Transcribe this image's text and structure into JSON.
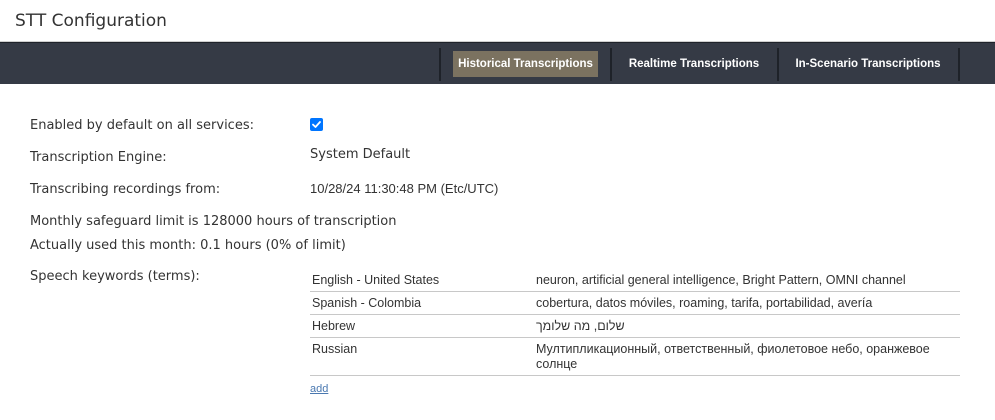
{
  "page": {
    "title": "STT Configuration"
  },
  "tabs": [
    {
      "label": "Historical Transcriptions",
      "active": true
    },
    {
      "label": "Realtime Transcriptions",
      "active": false
    },
    {
      "label": "In-Scenario Transcriptions",
      "active": false
    }
  ],
  "settings": {
    "enabled_label": "Enabled by default on all services:",
    "enabled_checked": true,
    "engine_label": "Transcription Engine:",
    "engine_value": "System Default",
    "recording_label": "Transcribing recordings from:",
    "recording_value": "10/28/24 11:30:48 PM (Etc/UTC)",
    "safeguard_text": "Monthly safeguard limit is 128000 hours of transcription",
    "usage_text": "Actually used this month: 0.1 hours (0% of limit)",
    "keywords_label": "Speech keywords (terms):"
  },
  "keywords": [
    {
      "language": "English - United States",
      "terms": "neuron, artificial general intelligence, Bright Pattern, OMNI channel"
    },
    {
      "language": "Spanish - Colombia",
      "terms": "cobertura, datos móviles, roaming, tarifa, portabilidad, avería"
    },
    {
      "language": "Hebrew",
      "terms": "שלום, מה שלומך"
    },
    {
      "language": "Russian",
      "terms": "Мултипликационный, ответственный, фиолетовое небо, оранжевое солнце"
    }
  ],
  "actions": {
    "add_label": "add"
  },
  "colors": {
    "tab_bar": "#353a45",
    "active_tab": "#7b7260",
    "checkbox": "#0075ff",
    "link": "#4a78b0"
  }
}
